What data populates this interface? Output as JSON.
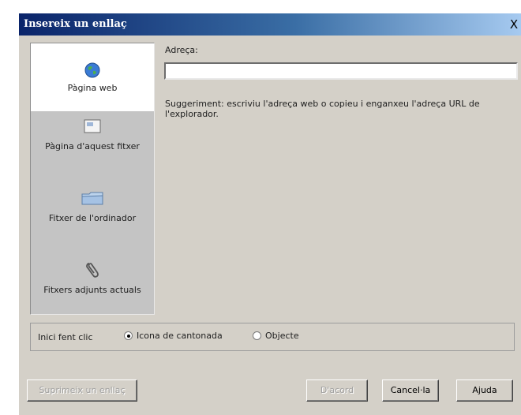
{
  "dialog": {
    "title": "Insereix un enllaç",
    "close_label": "X"
  },
  "sidebar": {
    "items": [
      {
        "label": "Pàgina web",
        "icon": "globe-icon",
        "selected": true
      },
      {
        "label": "Pàgina d'aquest fitxer",
        "icon": "page-icon",
        "selected": false
      },
      {
        "label": "Fitxer de l'ordinador",
        "icon": "folder-icon",
        "selected": false
      },
      {
        "label": "Fitxers adjunts actuals",
        "icon": "paperclip-icon",
        "selected": false
      }
    ]
  },
  "main": {
    "address_label": "Adreça:",
    "address_value": "",
    "hint": "Suggeriment: escriviu l'adreça web o copieu i enganxeu l'adreça URL de l'explorador."
  },
  "click_options": {
    "label": "Inici fent clic",
    "options": [
      {
        "label": "Icona de cantonada",
        "checked": true
      },
      {
        "label": "Objecte",
        "checked": false
      }
    ]
  },
  "buttons": {
    "remove_link": "Suprimeix un enllaç",
    "ok": "D'acord",
    "cancel": "Cancel·la",
    "help": "Ajuda"
  },
  "colors": {
    "title_gradient_start": "#0a246a",
    "title_gradient_end": "#a6caf0",
    "dialog_bg": "#d4d0c8",
    "sidebar_bg": "#c4c4c4",
    "selected_bg": "#ffffff"
  }
}
